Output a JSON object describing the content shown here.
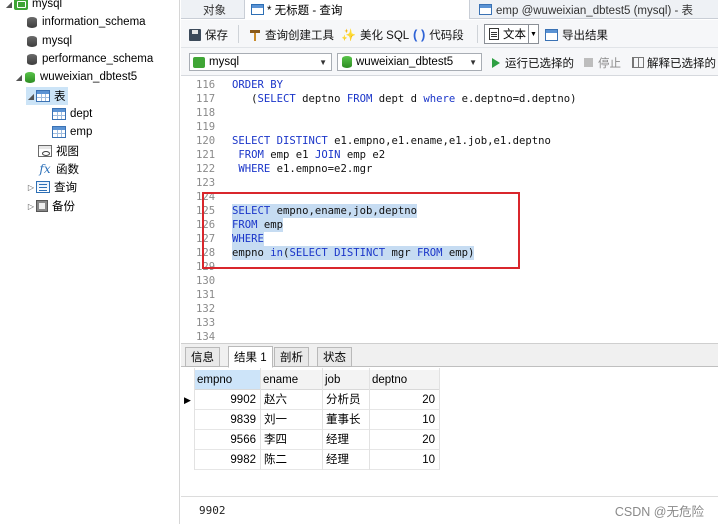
{
  "navigator": {
    "connection": "mysql",
    "databases": [
      "information_schema",
      "mysql",
      "performance_schema",
      "wuweixian_dbtest5"
    ],
    "tables_label": "表",
    "tables": [
      "dept",
      "emp"
    ],
    "views_label": "视图",
    "functions_label": "函数",
    "queries_label": "查询",
    "backups_label": "备份"
  },
  "tabs": {
    "objects": "对象",
    "query": "* 无标题 - 查询",
    "emp": "emp @wuweixian_dbtest5 (mysql) - 表"
  },
  "toolbar": {
    "save": "保存",
    "query_builder": "查询创建工具",
    "beautify": "美化 SQL",
    "code_snippet": "代码段",
    "text": "文本",
    "export": "导出结果",
    "connection": "mysql",
    "database": "wuweixian_dbtest5",
    "run_selected": "运行已选择的",
    "stop": "停止",
    "explain": "解释已选择的"
  },
  "editor": {
    "lines": [
      {
        "n": "116",
        "code": "ORDER BY"
      },
      {
        "n": "117",
        "code": "   (SELECT deptno FROM dept d where e.deptno=d.deptno)"
      },
      {
        "n": "118",
        "code": ""
      },
      {
        "n": "119",
        "code": ""
      },
      {
        "n": "120",
        "code": "SELECT DISTINCT e1.empno,e1.ename,e1.job,e1.deptno"
      },
      {
        "n": "121",
        "code": " FROM emp e1 JOIN emp e2"
      },
      {
        "n": "122",
        "code": " WHERE e1.empno=e2.mgr"
      },
      {
        "n": "123",
        "code": ""
      },
      {
        "n": "124",
        "code": ""
      },
      {
        "n": "125",
        "code": "SELECT empno,ename,job,deptno"
      },
      {
        "n": "126",
        "code": "FROM emp"
      },
      {
        "n": "127",
        "code": "WHERE"
      },
      {
        "n": "128",
        "code": "empno in(SELECT DISTINCT mgr FROM emp)"
      },
      {
        "n": "129",
        "code": ""
      },
      {
        "n": "130",
        "code": ""
      },
      {
        "n": "131",
        "code": ""
      },
      {
        "n": "132",
        "code": ""
      },
      {
        "n": "133",
        "code": ""
      },
      {
        "n": "134",
        "code": ""
      }
    ]
  },
  "result_tabs": [
    "信息",
    "结果 1",
    "剖析",
    "状态"
  ],
  "grid": {
    "columns": [
      "empno",
      "ename",
      "job",
      "deptno"
    ],
    "rows": [
      [
        "9902",
        "赵六",
        "分析员",
        "20"
      ],
      [
        "9839",
        "刘一",
        "董事长",
        "10"
      ],
      [
        "9566",
        "李四",
        "经理",
        "20"
      ],
      [
        "9982",
        "陈二",
        "经理",
        "10"
      ]
    ]
  },
  "status": {
    "value": "9902",
    "watermark": "CSDN @无危险"
  },
  "colors": {
    "keyword": "#1a35c9",
    "selection": "#c6dcf2",
    "highlight_box": "#d9262c"
  }
}
